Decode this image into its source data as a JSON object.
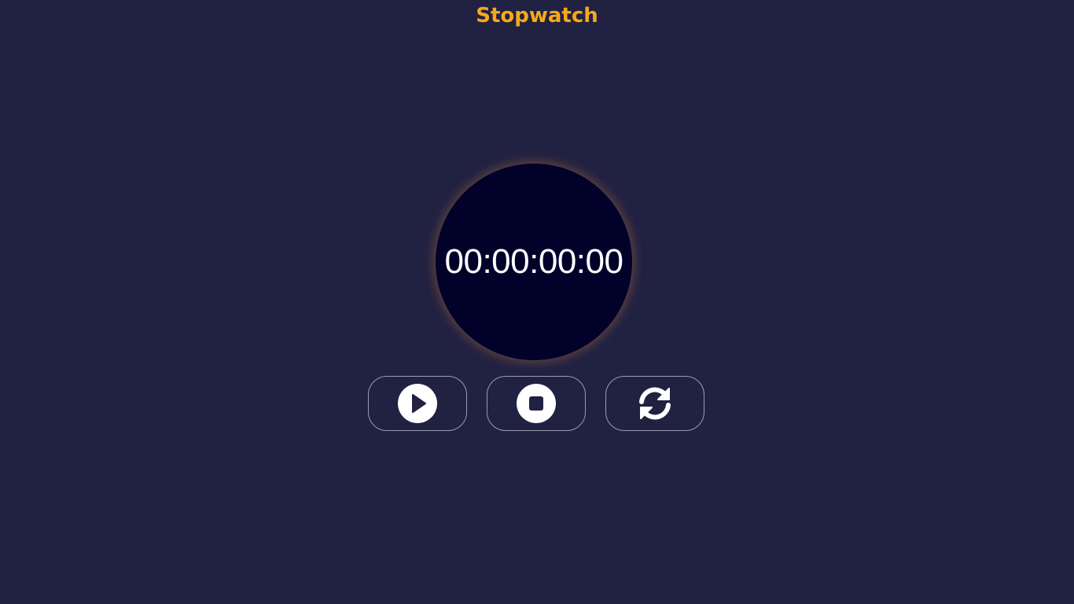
{
  "header": {
    "title": "Stopwatch"
  },
  "display": {
    "time": "00:00:00:00"
  },
  "controls": [
    {
      "name": "start",
      "icon": "play-circle-icon"
    },
    {
      "name": "stop",
      "icon": "stop-circle-icon"
    },
    {
      "name": "reset",
      "icon": "refresh-icon"
    }
  ],
  "colors": {
    "background": "#212142",
    "accent": "#f5a91a",
    "dial": "#01012a",
    "text": "#ffffff",
    "button_border": "#9b9bb0"
  }
}
